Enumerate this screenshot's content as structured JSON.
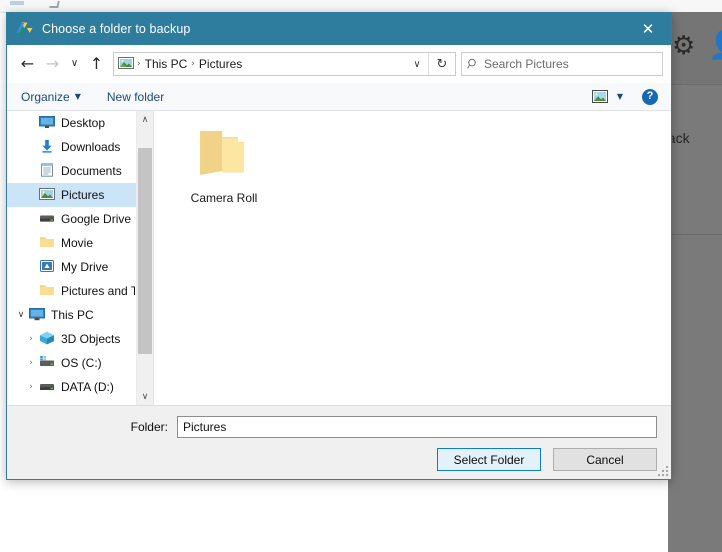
{
  "background": {
    "icons": {
      "gear": "gear-icon",
      "person": "person-icon"
    },
    "text_fragment": "back"
  },
  "dialog": {
    "title": "Choose a folder to backup",
    "app_logo": "google-drive-logo",
    "close_label": "✕",
    "nav": {
      "back": "←",
      "forward": "→",
      "recent": "∨",
      "up": "↑",
      "root_icon": "pictures-icon",
      "breadcrumbs": [
        "This PC",
        "Pictures"
      ],
      "separator": "›",
      "dropdown": "∨",
      "refresh": "↻"
    },
    "search": {
      "placeholder": "Search Pictures",
      "icon": "search-icon"
    },
    "toolbar": {
      "organize": "Organize",
      "organize_caret": "▼",
      "new_folder": "New folder",
      "view_icon": "view-mode-icon",
      "view_caret": "▼",
      "help": "?"
    },
    "tree": {
      "items": [
        {
          "label": "Desktop",
          "icon": "desktop-icon",
          "indent": 2,
          "expander": "",
          "pinned": true,
          "selected": false
        },
        {
          "label": "Downloads",
          "icon": "downloads-icon",
          "indent": 2,
          "expander": "",
          "pinned": true,
          "selected": false
        },
        {
          "label": "Documents",
          "icon": "documents-icon",
          "indent": 2,
          "expander": "",
          "pinned": true,
          "selected": false
        },
        {
          "label": "Pictures",
          "icon": "pictures-icon",
          "indent": 2,
          "expander": "",
          "pinned": true,
          "selected": true
        },
        {
          "label": "Google Drive",
          "icon": "drive-hdd-icon",
          "indent": 2,
          "expander": "",
          "pinned": true,
          "selected": false
        },
        {
          "label": "Movie",
          "icon": "folder-icon",
          "indent": 2,
          "expander": "",
          "pinned": false,
          "selected": false
        },
        {
          "label": "My Drive",
          "icon": "my-drive-icon",
          "indent": 2,
          "expander": "",
          "pinned": false,
          "selected": false
        },
        {
          "label": "Pictures and Tran",
          "icon": "folder-icon",
          "indent": 2,
          "expander": "",
          "pinned": false,
          "selected": false
        },
        {
          "label": "This PC",
          "icon": "this-pc-icon",
          "indent": 1,
          "expander": "∨",
          "pinned": false,
          "selected": false
        },
        {
          "label": "3D Objects",
          "icon": "3d-objects-icon",
          "indent": 2,
          "expander": "›",
          "pinned": false,
          "selected": false
        },
        {
          "label": "OS (C:)",
          "icon": "os-drive-icon",
          "indent": 2,
          "expander": "›",
          "pinned": false,
          "selected": false
        },
        {
          "label": "DATA (D:)",
          "icon": "data-drive-icon",
          "indent": 2,
          "expander": "›",
          "pinned": false,
          "selected": false
        }
      ],
      "scrollbar": {
        "up_arrow": "∧",
        "down_arrow": "∨"
      }
    },
    "content": {
      "items": [
        {
          "name": "Camera Roll",
          "icon": "folder-icon"
        }
      ]
    },
    "footer": {
      "folder_label": "Folder:",
      "folder_value": "Pictures",
      "select_button": "Select Folder",
      "cancel_button": "Cancel"
    }
  },
  "colors": {
    "titlebar": "#2e7d9e",
    "selection": "#cce4f7",
    "accent_link": "#1b4a7a",
    "folder_yellow": "#f7d785",
    "default_button_border": "#0f7dc4"
  }
}
